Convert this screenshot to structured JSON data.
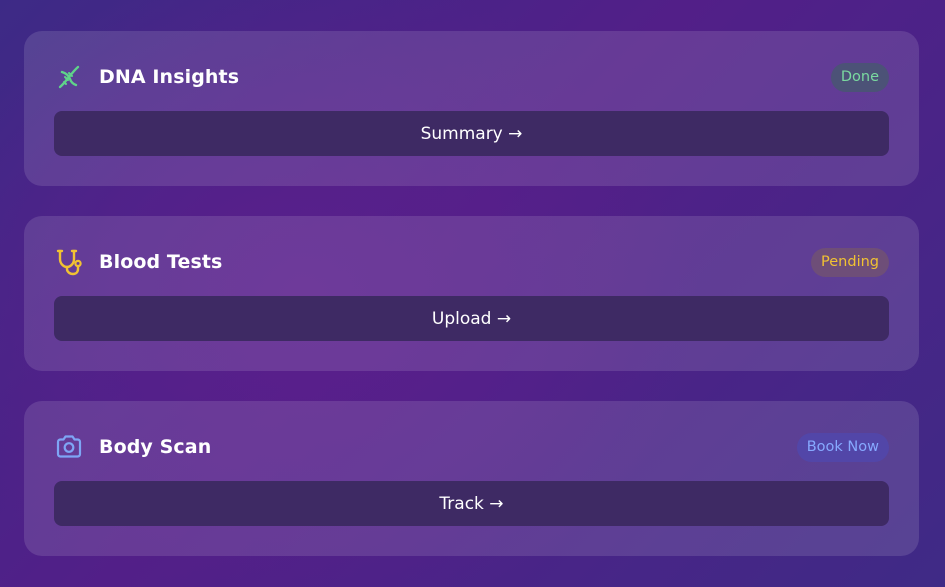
{
  "cards": [
    {
      "title": "DNA Insights",
      "icon": "dna-icon",
      "status": "Done",
      "status_color": "#7ad9a0",
      "action_label": "Summary →"
    },
    {
      "title": "Blood Tests",
      "icon": "stethoscope-icon",
      "status": "Pending",
      "status_color": "#f1c232",
      "action_label": "Upload →"
    },
    {
      "title": "Body Scan",
      "icon": "camera-icon",
      "status": "Book Now",
      "status_color": "#86a9ff",
      "action_label": "Track →"
    }
  ]
}
